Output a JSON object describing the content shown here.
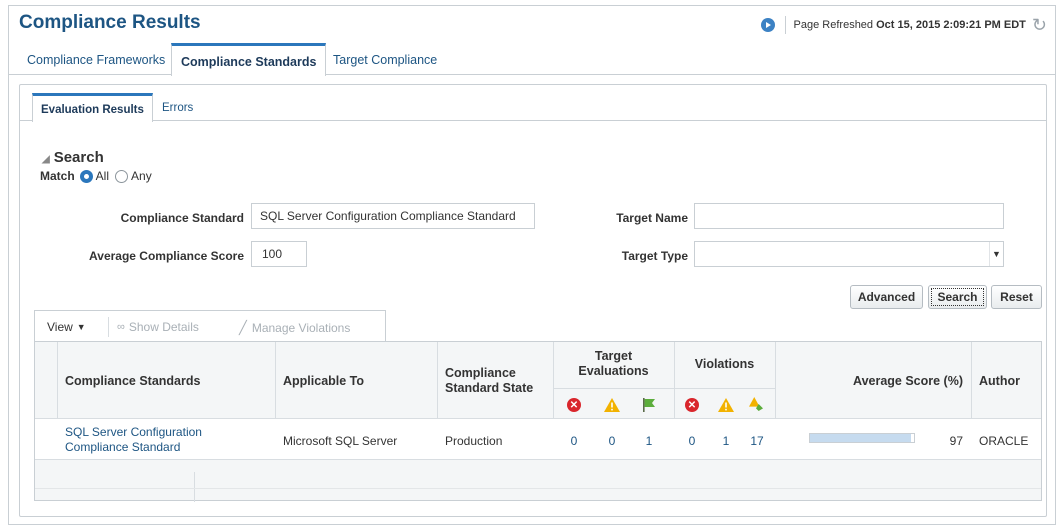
{
  "page": {
    "title": "Compliance Results",
    "refresh_label": "Page Refreshed",
    "refresh_time": "Oct 15, 2015 2:09:21 PM EDT"
  },
  "tabs_top": [
    {
      "label": "Compliance Frameworks",
      "active": false
    },
    {
      "label": "Compliance Standards",
      "active": true
    },
    {
      "label": "Target Compliance",
      "active": false
    }
  ],
  "tabs_sub": [
    {
      "label": "Evaluation Results",
      "active": true
    },
    {
      "label": "Errors",
      "active": false
    }
  ],
  "search": {
    "title": "Search",
    "match_label": "Match",
    "match_options": [
      "All",
      "Any"
    ],
    "match_selected": "All",
    "fields": {
      "compliance_standard": {
        "label": "Compliance Standard",
        "value": "SQL Server Configuration Compliance Standard"
      },
      "average_score": {
        "label": "Average Compliance Score",
        "value": "100"
      },
      "target_name": {
        "label": "Target Name",
        "value": ""
      },
      "target_type": {
        "label": "Target Type",
        "value": ""
      }
    },
    "buttons": {
      "advanced": "Advanced",
      "search": "Search",
      "reset": "Reset"
    }
  },
  "toolbar": {
    "view": "View",
    "show_details": "Show Details",
    "manage_violations": "Manage Violations"
  },
  "table": {
    "headers": {
      "standards": "Compliance Standards",
      "applicable_to": "Applicable To",
      "state_line1": "Compliance",
      "state_line2": "Standard State",
      "target_eval_line1": "Target",
      "target_eval_line2": "Evaluations",
      "violations": "Violations",
      "avg_score": "Average Score (%)",
      "author": "Author"
    },
    "icons": {
      "critical": "critical-icon",
      "warning": "warning-icon",
      "compliant": "compliant-flag-icon",
      "minor": "minor-warning-icon"
    },
    "rows": [
      {
        "standard_line1": "SQL Server Configuration",
        "standard_line2": "Compliance Standard",
        "applicable_to": "Microsoft SQL Server",
        "state": "Production",
        "target_eval_critical": "0",
        "target_eval_warning": "0",
        "target_eval_compliant": "1",
        "violations_critical": "0",
        "violations_warning": "1",
        "violations_minor": "17",
        "average_score": "97",
        "average_score_fraction": 0.97,
        "author": "ORACLE"
      }
    ]
  },
  "colors": {
    "accent": "#2b77bc",
    "title": "#1d5583",
    "critical": "#d9262c",
    "warning": "#f2b200",
    "compliant": "#5cad3c",
    "score_bar": "#c6dbef"
  }
}
